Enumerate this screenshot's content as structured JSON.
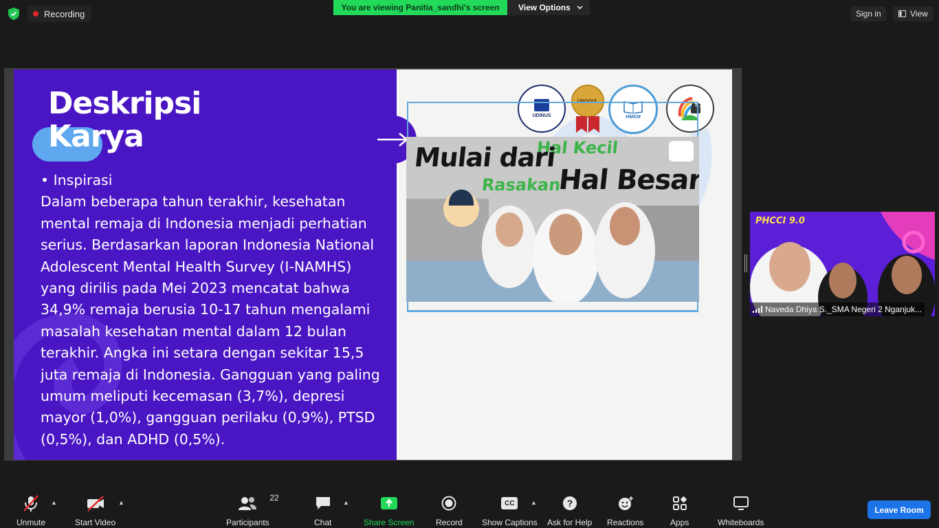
{
  "topbar": {
    "recording_label": "Recording",
    "viewing_banner": "You are viewing Panitia_sandhi's screen",
    "view_options_label": "View Options",
    "signin_label": "Sign in",
    "view_label": "View"
  },
  "slide": {
    "title_line1": "Deskripsi",
    "title_line2": "Karya",
    "bullet": "• Inspirasi",
    "body": "Dalam beberapa tahun terakhir, kesehatan mental remaja di Indonesia menjadi perhatian serius. Berdasarkan laporan Indonesia National Adolescent Mental Health Survey (I-NAMHS) yang dirilis pada Mei 2023 mencatat bahwa 34,9% remaja berusia 10-17 tahun mengalami masalah kesehatan mental dalam 12 bulan terakhir. Angka ini setara dengan sekitar 15,5 juta remaja di Indonesia. Gangguan yang paling umum meliputi kecemasan (3,7%), depresi mayor (1,0%), gangguan perilaku (0,9%), PTSD (0,5%), dan ADHD (0,5%).",
    "logos": {
      "udinus": "UDINUS",
      "unggul": "UNGGUL",
      "hmkm": "HMKM"
    },
    "poster": {
      "line1": "Mulai dari",
      "line2": "Hal Kecil",
      "line3": "Rasakan",
      "line4": "Hal Besar"
    }
  },
  "participant": {
    "name": "Naveda Dhiya S._SMA Negeri 2 Nganjuk...",
    "banner": "PHCCI 9.0"
  },
  "toolbar": {
    "unmute": "Unmute",
    "start_video": "Start Video",
    "participants": "Participants",
    "participants_count": "22",
    "chat": "Chat",
    "share_screen": "Share Screen",
    "record": "Record",
    "show_captions": "Show Captions",
    "captions_icon": "CC",
    "ask_for_help": "Ask for Help",
    "reactions": "Reactions",
    "apps": "Apps",
    "whiteboards": "Whiteboards",
    "leave_room": "Leave Room"
  },
  "colors": {
    "slide_purple": "#4a16c4",
    "share_green": "#23d959",
    "leave_blue": "#1d73e8"
  }
}
